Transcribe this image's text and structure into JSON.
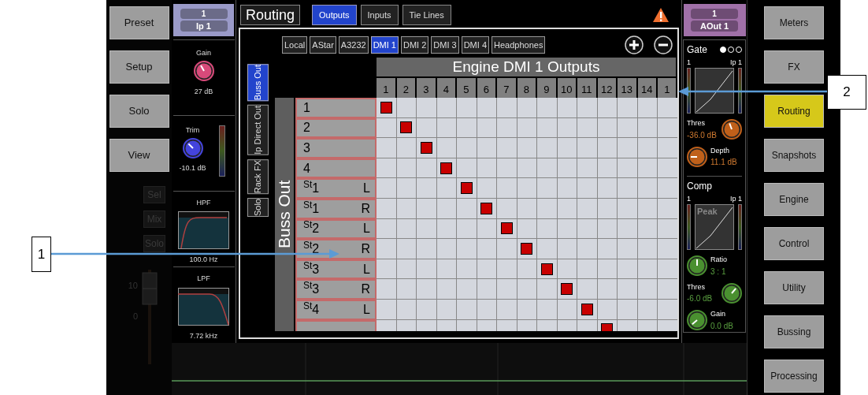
{
  "annotations": [
    {
      "label": "1"
    },
    {
      "label": "2"
    }
  ],
  "left_nav": {
    "buttons": [
      {
        "label": "Preset"
      },
      {
        "label": "Setup"
      },
      {
        "label": "Solo"
      },
      {
        "label": "View"
      }
    ]
  },
  "strip_buttons": [
    {
      "label": "Sel"
    },
    {
      "label": "Mix"
    },
    {
      "label": "Solo"
    }
  ],
  "fader": {
    "scale": [
      "10",
      "0"
    ]
  },
  "input_channel": {
    "number": "1",
    "name": "Ip 1",
    "gain": {
      "label": "Gain",
      "value": "27 dB"
    },
    "trim": {
      "label": "Trim",
      "value": "-10.1 dB"
    },
    "hpf": {
      "label": "HPF",
      "value": "100.0 Hz"
    },
    "lpf": {
      "label": "LPF",
      "value": "7.72 kHz"
    }
  },
  "routing": {
    "title": "Routing",
    "tabs": [
      {
        "label": "Outputs",
        "selected": true
      },
      {
        "label": "Inputs",
        "selected": false
      },
      {
        "label": "Tie Lines",
        "selected": false
      }
    ],
    "sources": [
      {
        "label": "Local",
        "selected": false
      },
      {
        "label": "AStar",
        "selected": false
      },
      {
        "label": "A3232",
        "selected": false
      },
      {
        "label": "DMI 1",
        "selected": true
      },
      {
        "label": "DMI 2",
        "selected": false
      },
      {
        "label": "DMI 3",
        "selected": false
      },
      {
        "label": "DMI 4",
        "selected": false
      },
      {
        "label": "Headphones",
        "selected": false
      }
    ],
    "source_groups": [
      {
        "label": "Buss Out",
        "selected": true
      },
      {
        "label": "Ip Direct Out",
        "selected": false
      },
      {
        "label": "Rack FX",
        "selected": false
      },
      {
        "label": "Solo",
        "selected": false
      }
    ],
    "group_label": "Buss Out",
    "grid_title": "Engine DMI 1 Outputs",
    "columns": [
      "1",
      "2",
      "3",
      "4",
      "5",
      "6",
      "7",
      "8",
      "9",
      "10",
      "11",
      "12",
      "13",
      "14",
      "1"
    ],
    "rows": [
      {
        "label": "1",
        "cells": [
          true,
          false,
          false,
          false,
          false,
          false,
          false,
          false,
          false,
          false,
          false,
          false,
          false,
          false,
          false
        ]
      },
      {
        "label": "2",
        "cells": [
          false,
          true,
          false,
          false,
          false,
          false,
          false,
          false,
          false,
          false,
          false,
          false,
          false,
          false,
          false
        ]
      },
      {
        "label": "3",
        "cells": [
          false,
          false,
          true,
          false,
          false,
          false,
          false,
          false,
          false,
          false,
          false,
          false,
          false,
          false,
          false
        ]
      },
      {
        "label": "4",
        "cells": [
          false,
          false,
          false,
          true,
          false,
          false,
          false,
          false,
          false,
          false,
          false,
          false,
          false,
          false,
          false
        ]
      },
      {
        "label": "$^{St}$1",
        "side": "L",
        "cells": [
          false,
          false,
          false,
          false,
          true,
          false,
          false,
          false,
          false,
          false,
          false,
          false,
          false,
          false,
          false
        ]
      },
      {
        "label": "$^{St}$1",
        "side": "R",
        "cells": [
          false,
          false,
          false,
          false,
          false,
          true,
          false,
          false,
          false,
          false,
          false,
          false,
          false,
          false,
          false
        ]
      },
      {
        "label": "$^{St}$2",
        "side": "L",
        "cells": [
          false,
          false,
          false,
          false,
          false,
          false,
          true,
          false,
          false,
          false,
          false,
          false,
          false,
          false,
          false
        ]
      },
      {
        "label": "$^{St}$2",
        "side": "R",
        "cells": [
          false,
          false,
          false,
          false,
          false,
          false,
          false,
          true,
          false,
          false,
          false,
          false,
          false,
          false,
          false
        ]
      },
      {
        "label": "$^{St}$3",
        "side": "L",
        "cells": [
          false,
          false,
          false,
          false,
          false,
          false,
          false,
          false,
          true,
          false,
          false,
          false,
          false,
          false,
          false
        ]
      },
      {
        "label": "$^{St}$3",
        "side": "R",
        "cells": [
          false,
          false,
          false,
          false,
          false,
          false,
          false,
          false,
          false,
          true,
          false,
          false,
          false,
          false,
          false
        ]
      },
      {
        "label": "$^{St}$4",
        "side": "L",
        "cells": [
          false,
          false,
          false,
          false,
          false,
          false,
          false,
          false,
          false,
          false,
          true,
          false,
          false,
          false,
          false
        ]
      },
      {
        "cells": [
          false,
          false,
          false,
          false,
          false,
          false,
          false,
          false,
          false,
          false,
          false,
          true,
          false,
          false,
          false
        ]
      }
    ]
  },
  "output_channel": {
    "number": "1",
    "name": "AOut 1",
    "gate": {
      "title": "Gate",
      "pages": [
        {
          "selected": true
        },
        {
          "selected": false
        },
        {
          "selected": false
        }
      ],
      "input": "1",
      "source": "Ip 1",
      "threshold": {
        "label": "Thres",
        "value": "-36.0 dB"
      },
      "depth": {
        "label": "Depth",
        "value": "11.1 dB"
      }
    },
    "comp": {
      "title": "Comp",
      "input": "1",
      "source": "Ip 1",
      "mode": "Peak",
      "ratio": {
        "label": "Ratio",
        "value": "3 : 1"
      },
      "threshold": {
        "label": "Thres",
        "value": "-6.0 dB"
      },
      "gain": {
        "label": "Gain",
        "value": "0.0 dB"
      }
    }
  },
  "right_nav": {
    "buttons": [
      {
        "label": "Meters",
        "selected": false
      },
      {
        "label": "FX",
        "selected": false
      },
      {
        "label": "Routing",
        "selected": true
      },
      {
        "label": "Snapshots",
        "selected": false
      },
      {
        "label": "Engine",
        "selected": false
      },
      {
        "label": "Control",
        "selected": false
      },
      {
        "label": "Utility",
        "selected": false
      },
      {
        "label": "Bussing",
        "selected": false
      },
      {
        "label": "Processing",
        "selected": false
      }
    ]
  }
}
